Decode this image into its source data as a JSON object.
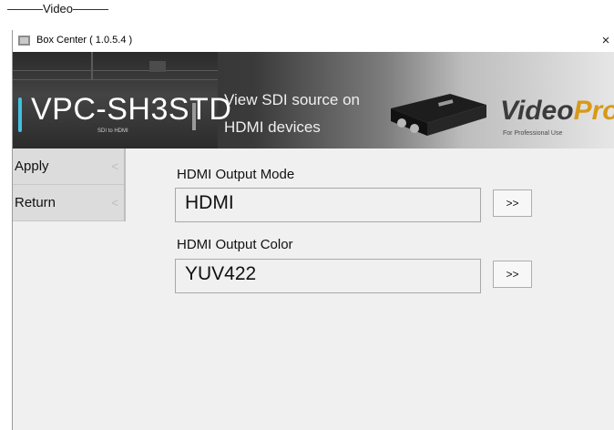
{
  "caption": "———Video———",
  "window": {
    "title": "Box Center ( 1.0.5.4 )",
    "close": "×"
  },
  "banner": {
    "model": "VPC-SH3STD",
    "model_sub": "SDI to HDMI",
    "tagline_1": "View SDI source on",
    "tagline_2": "HDMI devices",
    "logo_a": "Video",
    "logo_b": "Pro",
    "logo_sub": "For Professional Use"
  },
  "sidebar": {
    "items": [
      {
        "label": "Apply"
      },
      {
        "label": "Return"
      }
    ],
    "chevron": "<"
  },
  "settings": [
    {
      "label": "HDMI Output Mode",
      "value": "HDMI",
      "button": ">>"
    },
    {
      "label": "HDMI Output Color",
      "value": "YUV422",
      "button": ">>"
    }
  ],
  "colors": {
    "accent": "#40c0e0",
    "logo_orange": "#d79a18",
    "window_bg": "#f0f0f0"
  }
}
